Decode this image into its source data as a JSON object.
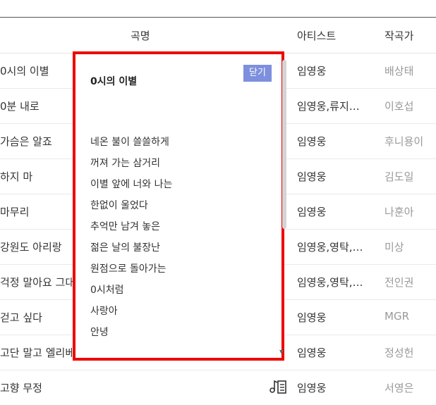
{
  "header": {
    "title": "곡명",
    "artist": "아티스트",
    "composer": "작곡가"
  },
  "rows": [
    {
      "title": "0시의 이별",
      "artist": "임영웅",
      "composer": "배상태"
    },
    {
      "title": "0분 내로",
      "artist": "임영웅,류지…",
      "composer": "이호섭"
    },
    {
      "title": "가슴은 알죠",
      "artist": "임영웅",
      "composer": "후니용이"
    },
    {
      "title": "하지 마",
      "artist": "임영웅",
      "composer": "김도일"
    },
    {
      "title": "마무리",
      "artist": "임영웅",
      "composer": "나훈아"
    },
    {
      "title": "강원도 아리랑",
      "artist": "임영웅,영탁,…",
      "composer": "미상"
    },
    {
      "title": "걱정 말아요 그대",
      "artist": "임영웅,영탁,…",
      "composer": "전인권"
    },
    {
      "title": "걷고 싶다",
      "artist": "임영웅",
      "composer": "MGR"
    },
    {
      "title": "고단 말고 엘리베이터",
      "artist": "임영웅",
      "composer": "정성헌"
    },
    {
      "title": "고향 무정",
      "artist": "임영웅",
      "composer": "서영은"
    }
  ],
  "popup": {
    "title": "0시의 이별",
    "close_label": "닫기",
    "lyrics": [
      "네온 불이 쓸쓸하게",
      "꺼져 가는 삼거리",
      "이별 앞에 너와 나는",
      "한없이 울었다",
      "추억만 남겨 놓은",
      "젊은 날의 불장난",
      "원점으로 돌아가는",
      "0시처럼",
      "사랑아",
      "안녕"
    ]
  },
  "icons": {
    "lyrics": "music-lyrics-icon",
    "scroll_down": "scroll-down-arrow-icon"
  },
  "colors": {
    "popup_border": "#ee0000",
    "close_button": "#7d8fdd",
    "composer_text": "#999999"
  }
}
